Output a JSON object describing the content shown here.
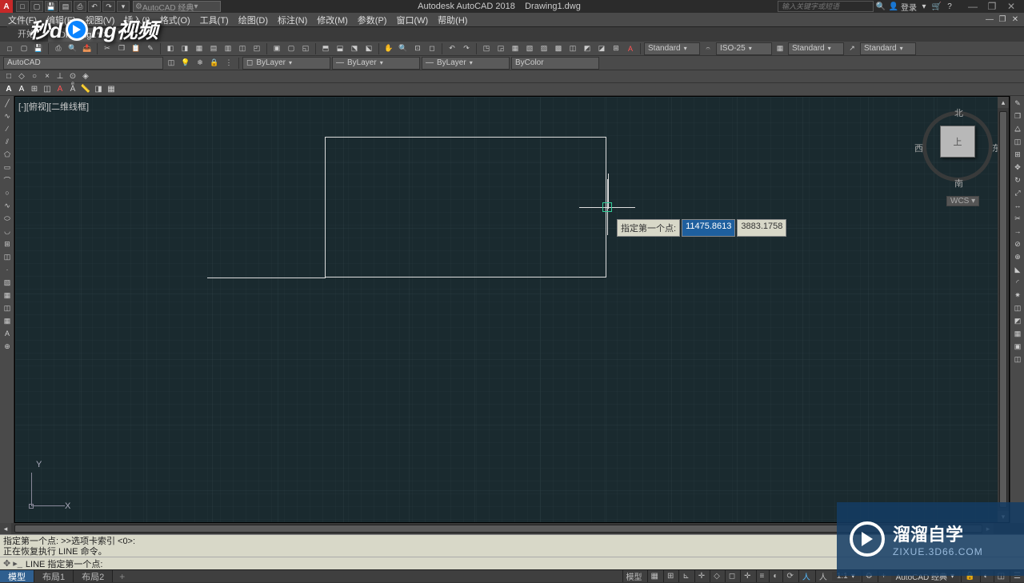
{
  "title": {
    "app": "Autodesk AutoCAD 2018",
    "doc": "Drawing1.dwg"
  },
  "menu": {
    "file": "文件(F)",
    "edit": "编辑(E)",
    "view": "视图(V)",
    "insert": "插入(I)",
    "format": "格式(O)",
    "tools": "工具(T)",
    "draw": "绘图(D)",
    "dim": "标注(N)",
    "modify": "修改(M)",
    "param": "参数(P)",
    "window": "窗口(W)",
    "help": "帮助(H)"
  },
  "work_search": "AutoCAD 经典",
  "infocenter": {
    "placeholder": "输入关键字或短语",
    "login": "登录"
  },
  "filetabs": {
    "tab0": "开始",
    "tab1": "Drawing1*"
  },
  "props": {
    "style1": "Standard",
    "style2": "ISO-25",
    "style3": "Standard",
    "style4": "Standard"
  },
  "layer": {
    "combo": "AutoCAD",
    "color": "ByLayer",
    "ltype": "ByLayer",
    "lweight": "ByLayer",
    "plot": "ByColor"
  },
  "canvas_label": "[-][俯视][二维线框]",
  "viewcube": {
    "top": "上",
    "n": "北",
    "s": "南",
    "e": "东",
    "w": "西",
    "wcs": "WCS"
  },
  "dyn": {
    "label": "指定第一个点:",
    "x": "11475.8613",
    "y": "3883.1758"
  },
  "ucs": {
    "x": "X",
    "y": "Y"
  },
  "cmd_history_1": "指定第一个点: >>选项卡索引 <0>:",
  "cmd_history_2": "正在恢复执行 LINE 命令。",
  "cmd_prompt": "LINE 指定第一个点:",
  "bottom_tabs": {
    "model": "模型",
    "layout1": "布局1",
    "layout2": "布局2"
  },
  "status": {
    "model": "模型",
    "scale": "1:1",
    "profile": "AutoCAD 经典"
  },
  "promo_left": "秒d  ng视频",
  "promo_right": {
    "t1": "溜溜自学",
    "t2": "ZIXUE.3D66.COM"
  }
}
